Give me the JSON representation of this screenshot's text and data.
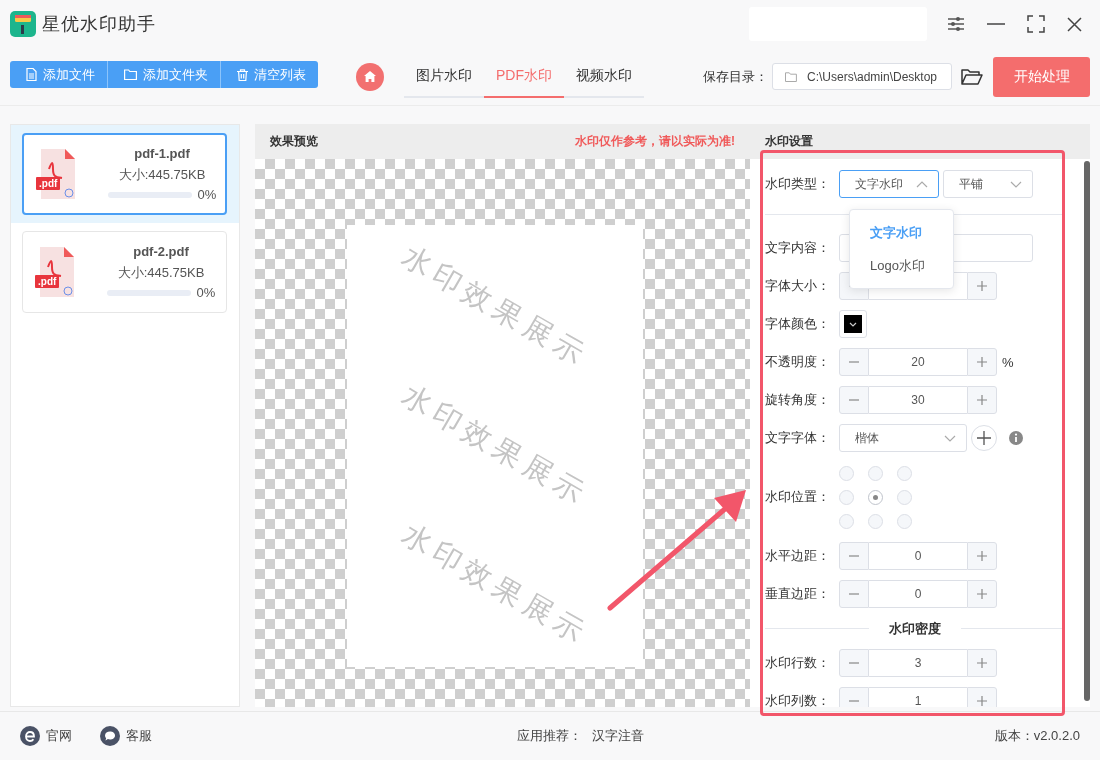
{
  "app": {
    "title": "星优水印助手"
  },
  "toolbar": {
    "buttons": [
      {
        "label": "添加文件",
        "kind": "file"
      },
      {
        "label": "添加文件夹",
        "kind": "folder"
      },
      {
        "label": "清空列表",
        "kind": "trash"
      }
    ]
  },
  "tabs": [
    {
      "label": "图片水印",
      "selected": false
    },
    {
      "label": "PDF水印",
      "selected": true
    },
    {
      "label": "视频水印",
      "selected": false
    }
  ],
  "save_dir": {
    "label": "保存目录：",
    "value": "C:\\Users\\admin\\Desktop"
  },
  "start_button": "开始处理",
  "files": [
    {
      "name": "pdf-1.pdf",
      "type": ".pdf",
      "size": "大小:445.75KB",
      "level": 0,
      "progress": "0%",
      "selected": true
    },
    {
      "name": "pdf-2.pdf",
      "type": ".pdf",
      "size": "大小:445.75KB",
      "level": 0,
      "progress": "0%",
      "selected": false
    }
  ],
  "preview": {
    "title": "效果预览",
    "notice": "水印仅作参考，请以实际为准!",
    "watermarks": [
      "水印效果展示",
      "水印效果展示",
      "水印效果展示"
    ]
  },
  "settings": {
    "title": "水印设置",
    "rows": [
      {
        "kind": "type",
        "label": "水印类型：",
        "value": "文字水印",
        "mode": "平铺",
        "open": true,
        "options": [
          {
            "label": "文字水印",
            "selected": true
          },
          {
            "label": "Logo水印",
            "selected": false
          }
        ]
      },
      {
        "kind": "divider"
      },
      {
        "kind": "input",
        "label": "文字内容："
      },
      {
        "kind": "stepper",
        "label": "字体大小："
      },
      {
        "kind": "color",
        "label": "字体颜色：",
        "color": "#000000"
      },
      {
        "kind": "stepper",
        "label": "不透明度：",
        "value": "20",
        "unit": "%"
      },
      {
        "kind": "stepper",
        "label": "旋转角度：",
        "value": "30"
      },
      {
        "kind": "font",
        "label": "文字字体：",
        "value": "楷体"
      },
      {
        "kind": "position",
        "label": "水印位置：",
        "positions": [
          {
            "selected": false
          },
          {
            "selected": false
          },
          {
            "selected": false
          },
          {
            "selected": false
          },
          {
            "selected": true
          },
          {
            "selected": false
          },
          {
            "selected": false
          },
          {
            "selected": false
          },
          {
            "selected": false
          }
        ]
      },
      {
        "kind": "stepper",
        "label": "水平边距：",
        "value": "0"
      },
      {
        "kind": "stepper",
        "label": "垂直边距：",
        "value": "0"
      },
      {
        "kind": "heading",
        "label": "水印密度"
      },
      {
        "kind": "stepper",
        "label": "水印行数：",
        "value": "3"
      },
      {
        "kind": "stepper",
        "label": "水印列数：",
        "value": "1"
      }
    ]
  },
  "footer": {
    "links": [
      {
        "label": "官网",
        "kind": "web"
      },
      {
        "label": "客服",
        "kind": "chat"
      }
    ],
    "recommend_label": "应用推荐：",
    "recommend_app": "汉字注音",
    "version": "版本：v2.0.2.0"
  }
}
